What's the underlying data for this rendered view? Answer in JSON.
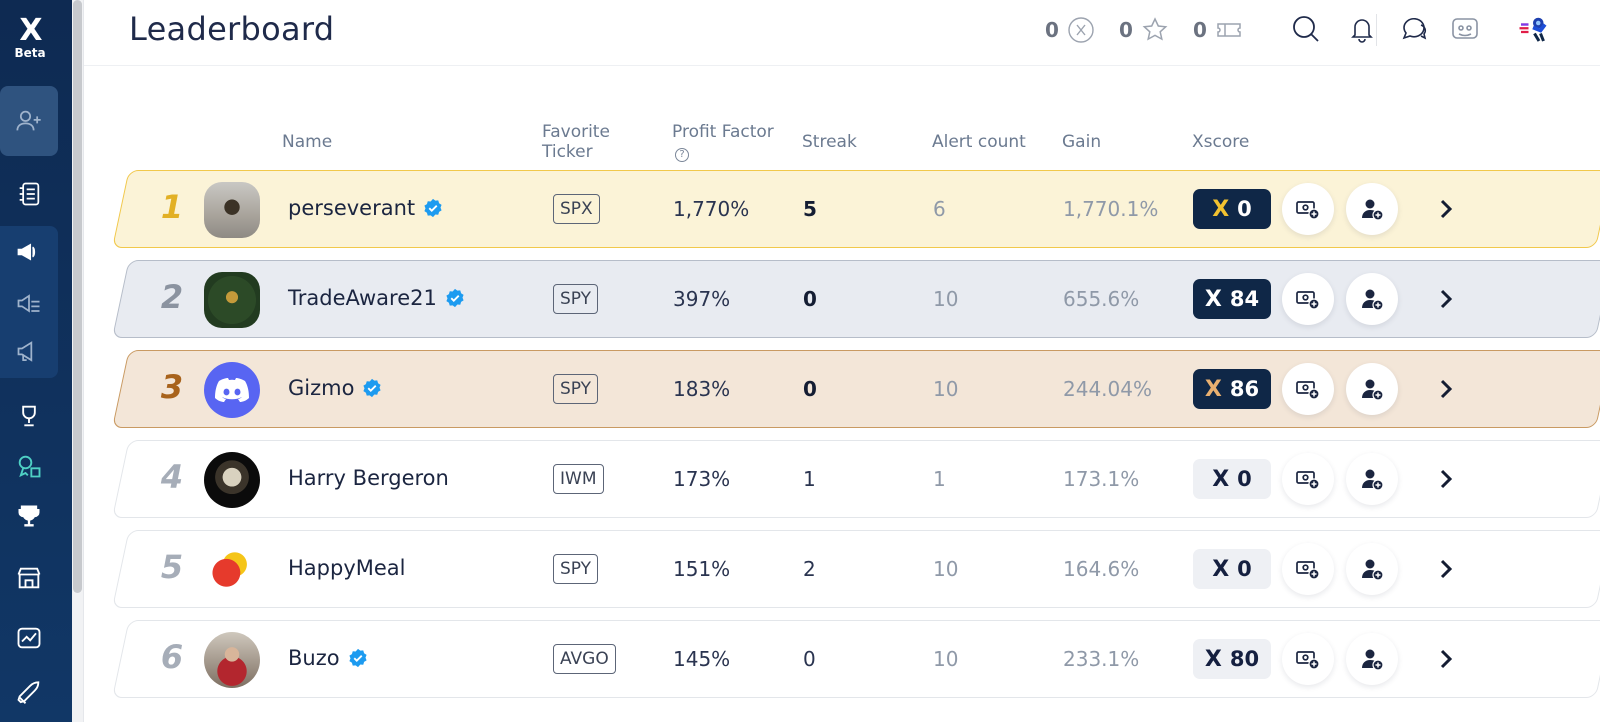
{
  "app": {
    "logo_text": "X",
    "beta_label": "Beta"
  },
  "header": {
    "title": "Leaderboard",
    "stats": [
      {
        "value": "0",
        "icon": "x-coin-icon"
      },
      {
        "value": "0",
        "icon": "star-icon"
      },
      {
        "value": "0",
        "icon": "ticket-icon"
      }
    ],
    "icons": [
      "search-icon",
      "bell-icon",
      "chat-icon",
      "discord-icon",
      "user-avatar"
    ]
  },
  "sidebar": {
    "items": [
      "add-user-icon",
      "journal-icon",
      "megaphone-icon",
      "megaphone-list-icon",
      "megaphone-alt-icon",
      "trophy-icon",
      "badge-user-icon",
      "trophy-solid-icon",
      "store-icon",
      "chart-icon",
      "rocket-icon"
    ]
  },
  "table": {
    "columns": {
      "name": "Name",
      "favorite_ticker": "Favorite Ticker",
      "profit_factor": "Profit Factor",
      "profit_factor_help": "?",
      "streak": "Streak",
      "alert_count": "Alert count",
      "gain": "Gain",
      "xscore": "Xscore"
    },
    "rows": [
      {
        "rank": "1",
        "name": "perseverant",
        "verified": true,
        "ticker": "SPX",
        "profit_factor": "1,770%",
        "streak": "5",
        "alerts": "6",
        "gain": "1,770.1%",
        "xscore": "0",
        "xmark": "X",
        "tier": "gold"
      },
      {
        "rank": "2",
        "name": "TradeAware21",
        "verified": true,
        "ticker": "SPY",
        "profit_factor": "397%",
        "streak": "0",
        "alerts": "10",
        "gain": "655.6%",
        "xscore": "84",
        "xmark": "X",
        "tier": "silver"
      },
      {
        "rank": "3",
        "name": "Gizmo",
        "verified": true,
        "ticker": "SPY",
        "profit_factor": "183%",
        "streak": "0",
        "alerts": "10",
        "gain": "244.04%",
        "xscore": "86",
        "xmark": "X",
        "tier": "bronze"
      },
      {
        "rank": "4",
        "name": "Harry Bergeron",
        "verified": false,
        "ticker": "IWM",
        "profit_factor": "173%",
        "streak": "1",
        "alerts": "1",
        "gain": "173.1%",
        "xscore": "0",
        "xmark": "X",
        "tier": "plain"
      },
      {
        "rank": "5",
        "name": "HappyMeal",
        "verified": false,
        "ticker": "SPY",
        "profit_factor": "151%",
        "streak": "2",
        "alerts": "10",
        "gain": "164.6%",
        "xscore": "0",
        "xmark": "X",
        "tier": "plain"
      },
      {
        "rank": "6",
        "name": "Buzo",
        "verified": true,
        "ticker": "AVGO",
        "profit_factor": "145%",
        "streak": "0",
        "alerts": "10",
        "gain": "233.1%",
        "xscore": "80",
        "xmark": "X",
        "tier": "plain"
      }
    ]
  },
  "colors": {
    "sidebar": "#0e2a52",
    "gold_row": "#fbf3d7",
    "silver_row": "#e8ebf1",
    "bronze_row": "#f3e6d8",
    "xscore_dark": "#0f2747",
    "verified": "#1d9bf0"
  }
}
